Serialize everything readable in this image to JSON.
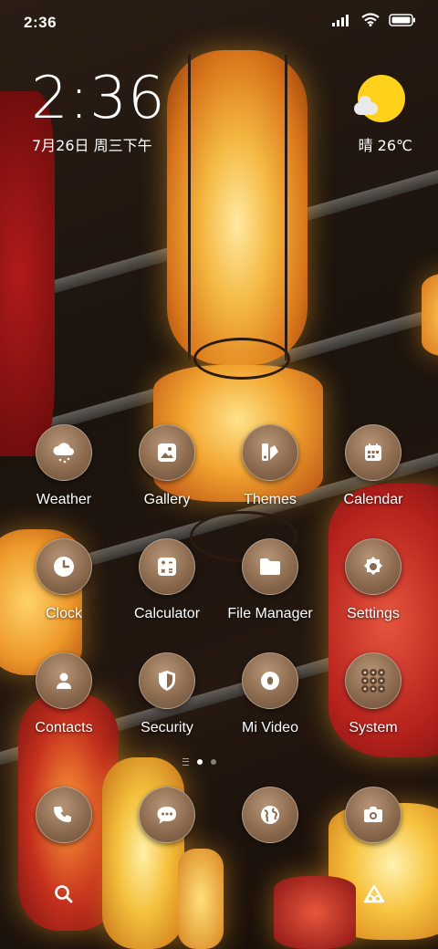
{
  "status_bar": {
    "time": "2:36",
    "icons": [
      "signal-icon",
      "wifi-icon",
      "battery-icon"
    ]
  },
  "clock_widget": {
    "time": "2:36",
    "date": "7月26日 周三下午"
  },
  "weather_widget": {
    "icon": "partly-sunny-icon",
    "text": "晴 26℃",
    "sun_color": "#ffd11a"
  },
  "apps": [
    {
      "label": "Weather",
      "icon": "cloud-rain-icon"
    },
    {
      "label": "Gallery",
      "icon": "image-icon"
    },
    {
      "label": "Themes",
      "icon": "themes-icon"
    },
    {
      "label": "Calendar",
      "icon": "calendar-icon"
    },
    {
      "label": "Clock",
      "icon": "clock-icon"
    },
    {
      "label": "Calculator",
      "icon": "calculator-icon"
    },
    {
      "label": "File Manager",
      "icon": "folder-icon"
    },
    {
      "label": "Settings",
      "icon": "gear-icon"
    },
    {
      "label": "Contacts",
      "icon": "person-icon"
    },
    {
      "label": "Security",
      "icon": "shield-icon"
    },
    {
      "label": "Mi Video",
      "icon": "video-icon"
    },
    {
      "label": "System",
      "icon": "folder-grid-icon"
    }
  ],
  "page_indicator": {
    "pages": 2,
    "current": 1
  },
  "dock": [
    {
      "name": "phone",
      "icon": "phone-icon"
    },
    {
      "name": "messages",
      "icon": "chat-icon"
    },
    {
      "name": "browser",
      "icon": "globe-icon"
    },
    {
      "name": "camera",
      "icon": "camera-icon"
    }
  ],
  "bottom_bar": [
    {
      "name": "search",
      "icon": "search-icon"
    },
    {
      "name": "assistant",
      "icon": "assistant-icon"
    }
  ],
  "colors": {
    "icon_bg": "#8b6a4e",
    "text": "#ffffff"
  }
}
